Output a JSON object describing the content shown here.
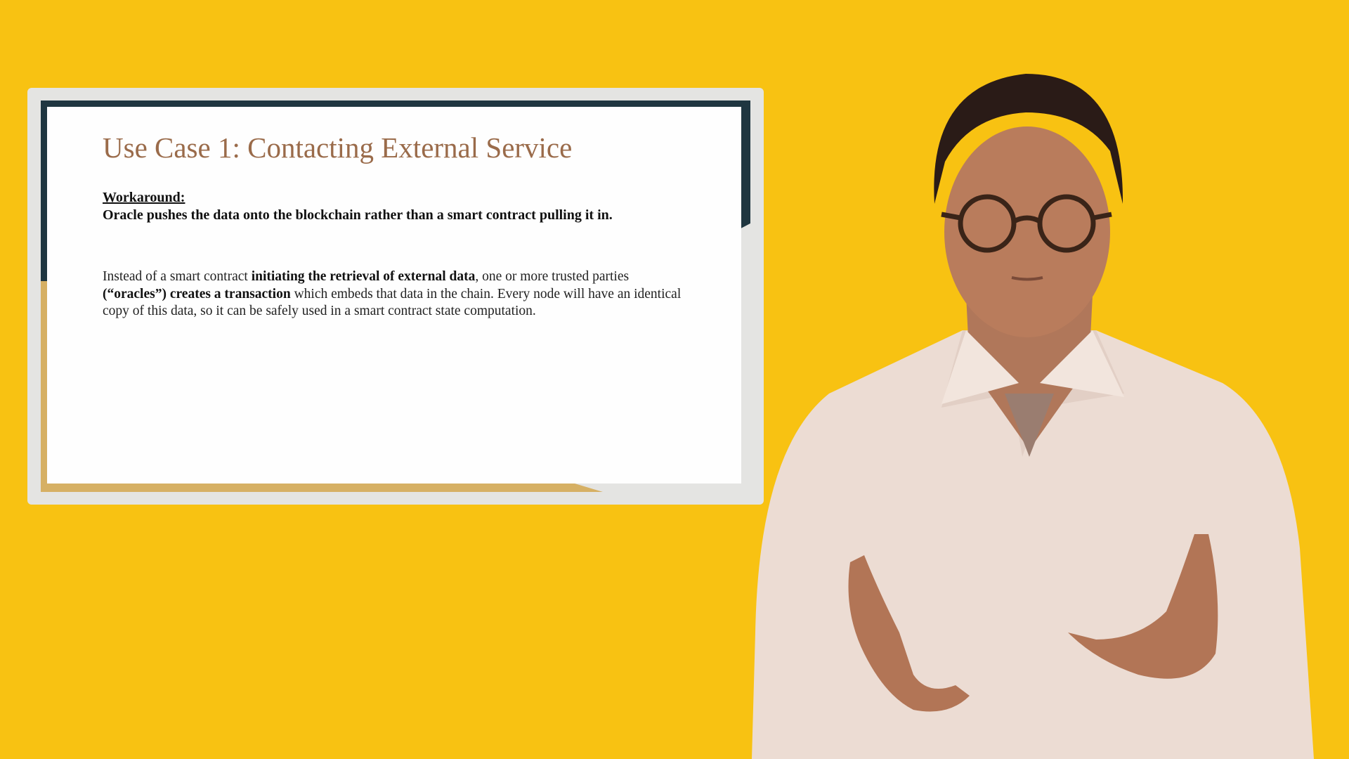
{
  "slide": {
    "title": "Use Case 1: Contacting External Service",
    "workaround_label": "Workaround:",
    "workaround_text": "Oracle pushes the data onto the blockchain rather than a smart contract pulling it in.",
    "body": {
      "p1": "Instead of a smart contract ",
      "b1": "initiating the retrieval of external data",
      "p2": ", one or more trusted parties ",
      "b2": "(“oracles”) creates a transaction",
      "p3": " which embeds that data in the chain. Every node will have an identical copy of this data, so it can be safely used in a smart contract state computation."
    }
  },
  "colors": {
    "background": "#f8c212",
    "title": "#9a6b4a",
    "accent_dark": "#1f3640",
    "accent_gold": "#d6b064"
  }
}
